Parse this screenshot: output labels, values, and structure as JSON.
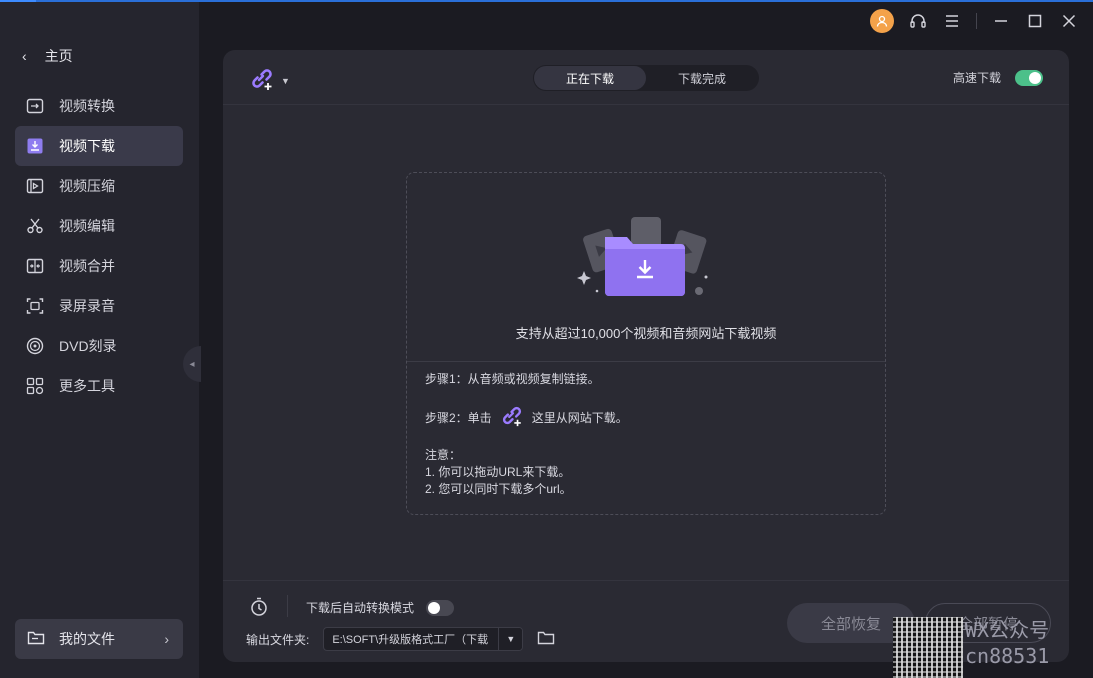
{
  "sidebar": {
    "home_label": "主页",
    "items": [
      {
        "label": "视频转换",
        "icon": "convert-icon",
        "active": false
      },
      {
        "label": "视频下载",
        "icon": "download-icon",
        "active": true
      },
      {
        "label": "视频压缩",
        "icon": "compress-icon",
        "active": false
      },
      {
        "label": "视频编辑",
        "icon": "scissors-icon",
        "active": false
      },
      {
        "label": "视频合并",
        "icon": "merge-icon",
        "active": false
      },
      {
        "label": "录屏录音",
        "icon": "screen-record-icon",
        "active": false
      },
      {
        "label": "DVD刻录",
        "icon": "dvd-icon",
        "active": false
      },
      {
        "label": "更多工具",
        "icon": "more-tools-icon",
        "active": false
      }
    ],
    "my_files_label": "我的文件"
  },
  "header": {
    "tabs": [
      {
        "label": "正在下载",
        "active": true
      },
      {
        "label": "下载完成",
        "active": false
      }
    ],
    "speed_label": "高速下载",
    "speed_enabled": true
  },
  "dropzone": {
    "title": "支持从超过10,000个视频和音频网站下载视频",
    "step1": "步骤1：从音频或视频复制链接。",
    "step2_prefix": "步骤2：单击",
    "step2_suffix": "这里从网站下载。",
    "notes_title": "注意：",
    "note1": "1. 你可以拖动URL来下载。",
    "note2": "2. 您可以同时下载多个url。"
  },
  "footer": {
    "auto_convert_label": "下载后自动转换模式",
    "auto_convert_enabled": false,
    "output_label": "输出文件夹:",
    "output_path": "E:\\SOFT\\升级版格式工厂（下载",
    "resume_all": "全部恢复",
    "pause_all": "全部暂停"
  },
  "watermark": {
    "line1": "WX公众号",
    "line2": "cn88531"
  },
  "colors": {
    "accent_purple": "#9b7bff",
    "toggle_on": "#4cc08a",
    "avatar": "#f4a24a"
  }
}
